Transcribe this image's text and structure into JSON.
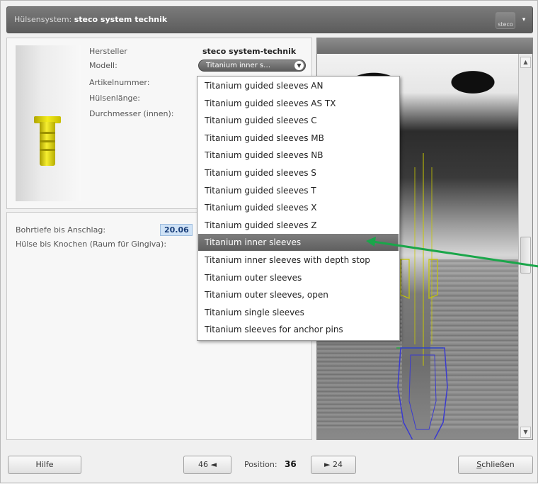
{
  "titlebar": {
    "label": "Hülsensystem:",
    "system": "steco system technik",
    "logo_text": "steco",
    "menu_arrow": "▾"
  },
  "info": {
    "hersteller_label": "Hersteller",
    "hersteller_value": "steco system-technik",
    "modell_label": "Modell:",
    "modell_value": "Titanium inner s…",
    "artikelnummer_label": "Artikelnummer:",
    "huelsenlaenge_label": "Hülsenlänge:",
    "durchmesser_label": "Durchmesser (innen):"
  },
  "depth": {
    "bohrtiefe_label": "Bohrtiefe bis Anschlag:",
    "bohrtiefe_value": "20.06",
    "huelse_label": "Hülse bis Knochen (Raum für Gingiva):"
  },
  "dropdown": {
    "items": [
      "Titanium guided sleeves AN",
      "Titanium guided sleeves AS TX",
      "Titanium guided sleeves C",
      "Titanium guided sleeves MB",
      "Titanium guided sleeves NB",
      "Titanium guided sleeves S",
      "Titanium guided sleeves T",
      "Titanium guided sleeves X",
      "Titanium guided sleeves Z",
      "Titanium inner sleeves",
      "Titanium inner sleeves with depth stop",
      "Titanium outer sleeves",
      "Titanium outer sleeves, open",
      "Titanium single sleeves",
      "Titanium sleeves for anchor pins"
    ],
    "selected_index": 9
  },
  "footer": {
    "help_label": "Hilfe",
    "prev_label": "46 ◄",
    "position_label": "Position:",
    "position_value": "36",
    "next_label": "► 24",
    "close_label": "Schließen"
  },
  "colors": {
    "annotation_arrow": "#1aa64a",
    "implant_outline": "#3a3ad0",
    "sleeve_outline": "#c8c800",
    "dropdown_highlight": "#6a6a6a"
  },
  "icons": [
    "steco-logo-icon",
    "chevron-down-icon",
    "scroll-up-icon",
    "scroll-down-icon"
  ]
}
